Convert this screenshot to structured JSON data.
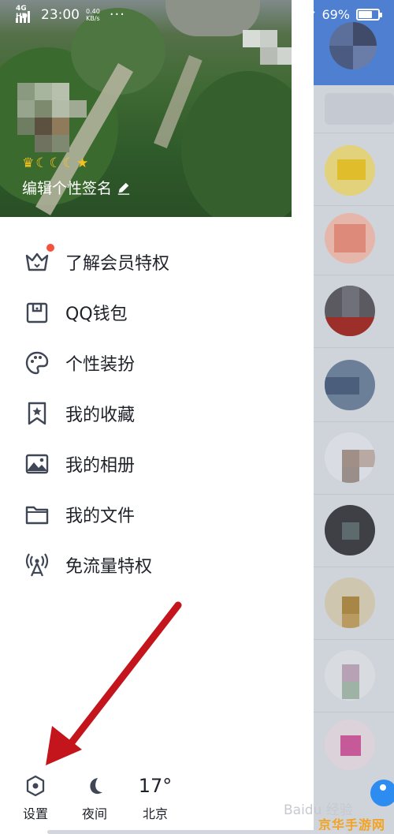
{
  "status_bar": {
    "network": "4G HD",
    "time": "23:00",
    "speed_value": "0.40",
    "speed_unit": "KB/s",
    "notification_dots": "···",
    "battery_percent": "69%",
    "battery_level": 0.69
  },
  "profile": {
    "badges": [
      "crown",
      "moon",
      "moon",
      "moon",
      "crown"
    ],
    "signature": "编辑个性签名"
  },
  "menu": {
    "items": [
      {
        "label": "了解会员特权",
        "icon": "crown-icon",
        "has_badge": true
      },
      {
        "label": "QQ钱包",
        "icon": "wallet-icon"
      },
      {
        "label": "个性装扮",
        "icon": "palette-icon"
      },
      {
        "label": "我的收藏",
        "icon": "bookmark-icon"
      },
      {
        "label": "我的相册",
        "icon": "photo-album-icon"
      },
      {
        "label": "我的文件",
        "icon": "folder-icon"
      },
      {
        "label": "免流量特权",
        "icon": "antenna-icon"
      }
    ]
  },
  "bottom_bar": {
    "settings_label": "设置",
    "night_label": "夜间",
    "weather_temp": "17°",
    "weather_city": "北京"
  },
  "watermark": {
    "baidu": "Baidu 经验",
    "site": "京华手游网"
  },
  "colors": {
    "accent_blue": "#4e7fd0",
    "badge_red": "#f5503c",
    "arrow_red": "#c4141c",
    "icon_gray": "#3f4656",
    "crown_gold": "#f4c21f"
  }
}
